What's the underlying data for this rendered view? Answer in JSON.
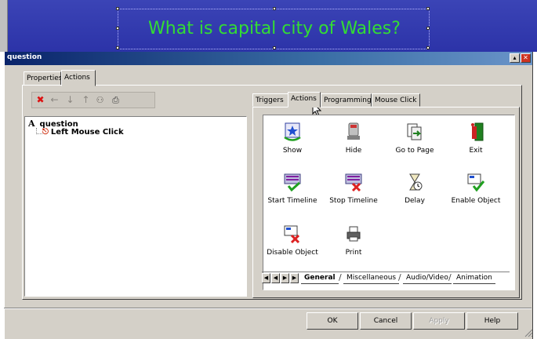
{
  "slide": {
    "title": "What is capital city of Wales?"
  },
  "dialog": {
    "title": "question"
  },
  "outer_tabs": [
    "Properties",
    "Actions"
  ],
  "toolbar_icons": [
    "delete-icon",
    "arrow-left-icon",
    "arrow-down-icon",
    "arrow-up-icon",
    "people-icon",
    "print-icon"
  ],
  "tree": {
    "root_letter": "A",
    "root_label": "question",
    "child_label": "Left Mouse Click"
  },
  "inner_tabs": [
    "Triggers",
    "Actions",
    "Programming",
    "Mouse Click"
  ],
  "actions": [
    {
      "label": "Show",
      "icon": "show-icon"
    },
    {
      "label": "Hide",
      "icon": "hide-icon"
    },
    {
      "label": "Go to Page",
      "icon": "go-to-page-icon"
    },
    {
      "label": "Exit",
      "icon": "exit-icon"
    },
    {
      "label": "Start Timeline",
      "icon": "start-timeline-icon"
    },
    {
      "label": "Stop Timeline",
      "icon": "stop-timeline-icon"
    },
    {
      "label": "Delay",
      "icon": "delay-icon"
    },
    {
      "label": "Enable Object",
      "icon": "enable-object-icon"
    },
    {
      "label": "Disable Object",
      "icon": "disable-object-icon"
    },
    {
      "label": "Print",
      "icon": "print-icon"
    }
  ],
  "category_tabs": [
    "General",
    "Miscellaneous",
    "Audio/Video",
    "Animation"
  ],
  "buttons": {
    "ok": "OK",
    "cancel": "Cancel",
    "apply": "Apply",
    "help": "Help"
  },
  "colors": {
    "title_bar": "#0a246a",
    "slide_bg": "#3b44b6",
    "title_text": "#33dd33",
    "dialog_bg": "#d4d0c8"
  }
}
